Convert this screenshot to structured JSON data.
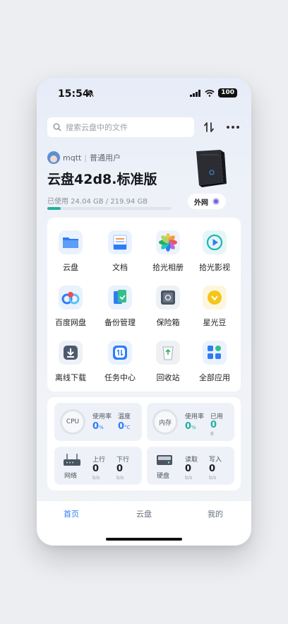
{
  "status": {
    "time": "15:54",
    "battery": "100"
  },
  "search": {
    "placeholder": "搜索云盘中的文件"
  },
  "user": {
    "name": "mqtt",
    "role": "普通用户"
  },
  "device": {
    "title": "云盘42d8.标准版",
    "usage_text": "已使用 24.04 GB / 219.94 GB",
    "usage_fraction": 0.109,
    "network": "外网"
  },
  "apps": [
    {
      "label": "云盘",
      "icon": "folder-icon"
    },
    {
      "label": "文档",
      "icon": "document-icon"
    },
    {
      "label": "拾光相册",
      "icon": "photos-icon"
    },
    {
      "label": "拾光影视",
      "icon": "video-play-icon"
    },
    {
      "label": "百度网盘",
      "icon": "baidu-netdisk-icon"
    },
    {
      "label": "备份管理",
      "icon": "backup-icon"
    },
    {
      "label": "保险箱",
      "icon": "safe-icon"
    },
    {
      "label": "星光豆",
      "icon": "star-bean-icon"
    },
    {
      "label": "离线下载",
      "icon": "download-icon"
    },
    {
      "label": "任务中心",
      "icon": "task-center-icon"
    },
    {
      "label": "回收站",
      "icon": "recycle-bin-icon"
    },
    {
      "label": "全部应用",
      "icon": "all-apps-icon"
    }
  ],
  "stats": {
    "cpu": {
      "name": "CPU",
      "usage_label": "使用率",
      "usage_value": "0",
      "usage_unit": "%",
      "temp_label": "温度",
      "temp_value": "0",
      "temp_unit": "°C"
    },
    "memory": {
      "name": "内存",
      "usage_label": "使用率",
      "usage_value": "0",
      "usage_unit": "%",
      "used_label": "已用",
      "used_value": "0",
      "used_unit": "B"
    },
    "network": {
      "name": "网络",
      "up_label": "上行",
      "up_value": "0",
      "up_unit": "b/s",
      "down_label": "下行",
      "down_value": "0",
      "down_unit": "b/s"
    },
    "disk": {
      "name": "硬盘",
      "read_label": "读取",
      "read_value": "0",
      "read_unit": "b/s",
      "write_label": "写入",
      "write_value": "0",
      "write_unit": "b/s"
    }
  },
  "tabs": [
    {
      "label": "首页",
      "active": true
    },
    {
      "label": "云盘",
      "active": false
    },
    {
      "label": "我的",
      "active": false
    }
  ],
  "colors": {
    "accent": "#2f7df6",
    "teal": "#22b0a0",
    "usage_bar": "#22b0a0"
  }
}
